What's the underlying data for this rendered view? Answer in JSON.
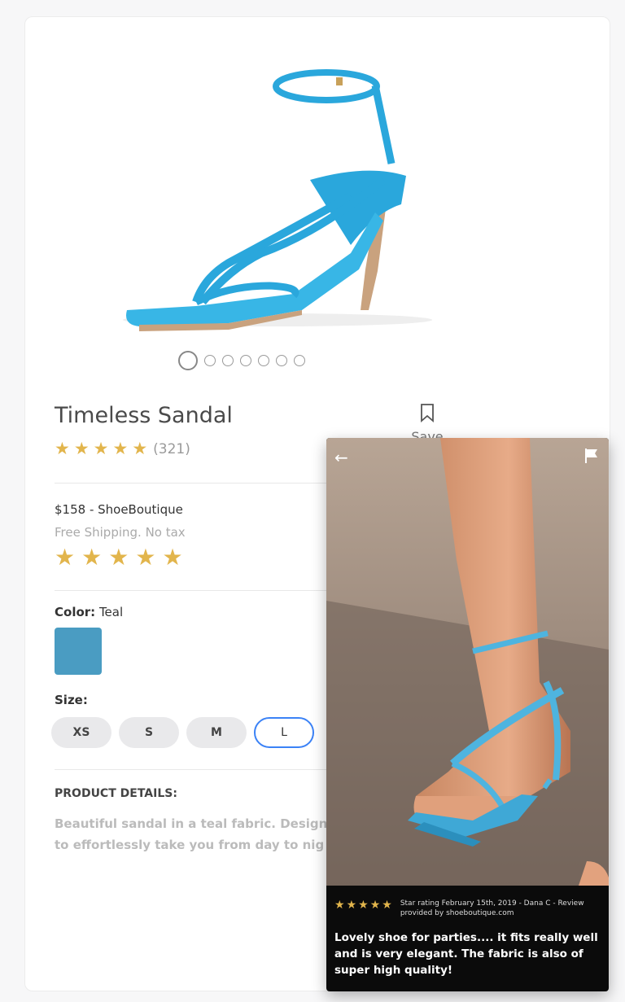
{
  "product": {
    "title": "Timeless Sandal",
    "rating": 5,
    "review_count": "(321)",
    "save_label": "Save",
    "price_seller": "$158 - ShoeBoutique",
    "shipping": "Free Shipping.  No tax",
    "seller_rating": 5,
    "carousel": {
      "count": 7,
      "active": 1
    },
    "color_label": "Color:",
    "color_value": "Teal",
    "color_hex": "#4a9cc2",
    "size_label": "Size:",
    "sizes": [
      "XS",
      "S",
      "M",
      "L"
    ],
    "selected_size": "L",
    "details_heading": "PRODUCT DETAILS:",
    "details_text": "Beautiful sandal in a teal fabric. Design\nto effortlessly take you from day to nig"
  },
  "review": {
    "stars": 5,
    "info": "Star rating February 15th, 2019 - Dana C - Review provided by shoeboutique.com",
    "text": "Lovely shoe for parties.... it fits really well and is very elegant. The fabric is also of super high quality!"
  },
  "colors": {
    "star": "#e2b54c",
    "selected_border": "#3b82f6",
    "sandal": "#3bb2e2"
  }
}
